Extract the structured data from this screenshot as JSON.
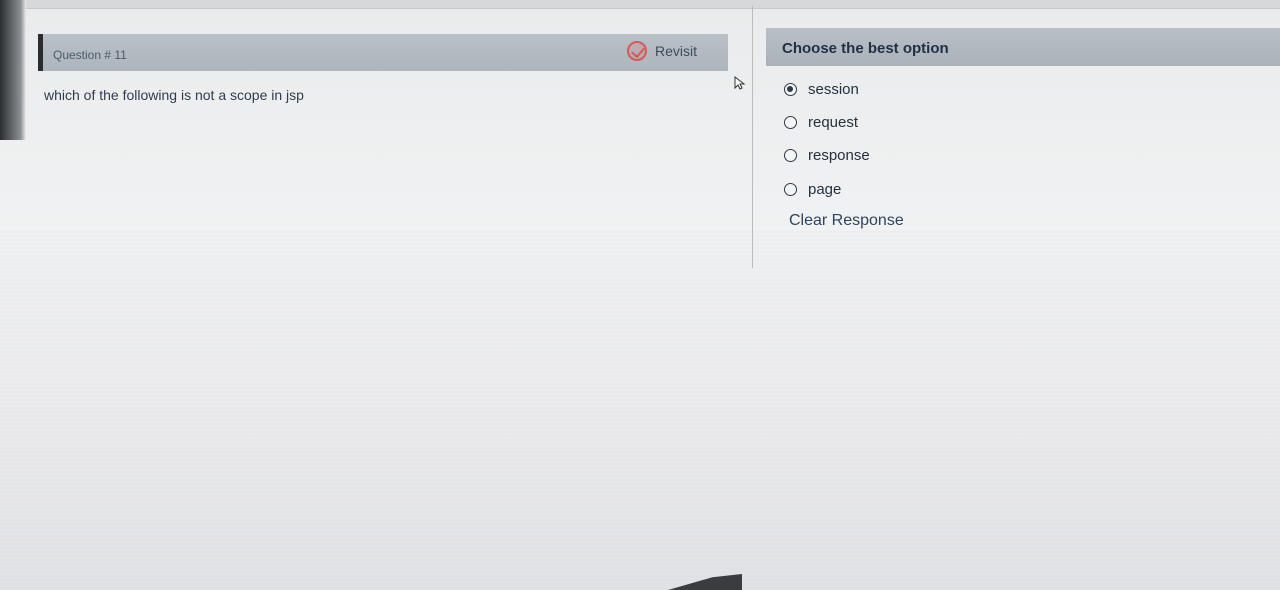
{
  "question": {
    "number_label": "Question # 11",
    "revisit_label": "Revisit",
    "text": "which of the following is not a scope in jsp"
  },
  "options_panel": {
    "title": "Choose the best option",
    "options": [
      {
        "label": "session",
        "selected": true
      },
      {
        "label": "request",
        "selected": false
      },
      {
        "label": "response",
        "selected": false
      },
      {
        "label": "page",
        "selected": false
      }
    ],
    "clear_label": "Clear Response"
  },
  "colors": {
    "header_bg": "#b3bac2",
    "accent_red": "#d45a5a",
    "text_dark": "#24313f"
  },
  "icons": {
    "revisit": "revisit-check-icon",
    "cursor": "mouse-cursor-icon",
    "radio_on": "radio-selected-icon",
    "radio_off": "radio-empty-icon"
  }
}
